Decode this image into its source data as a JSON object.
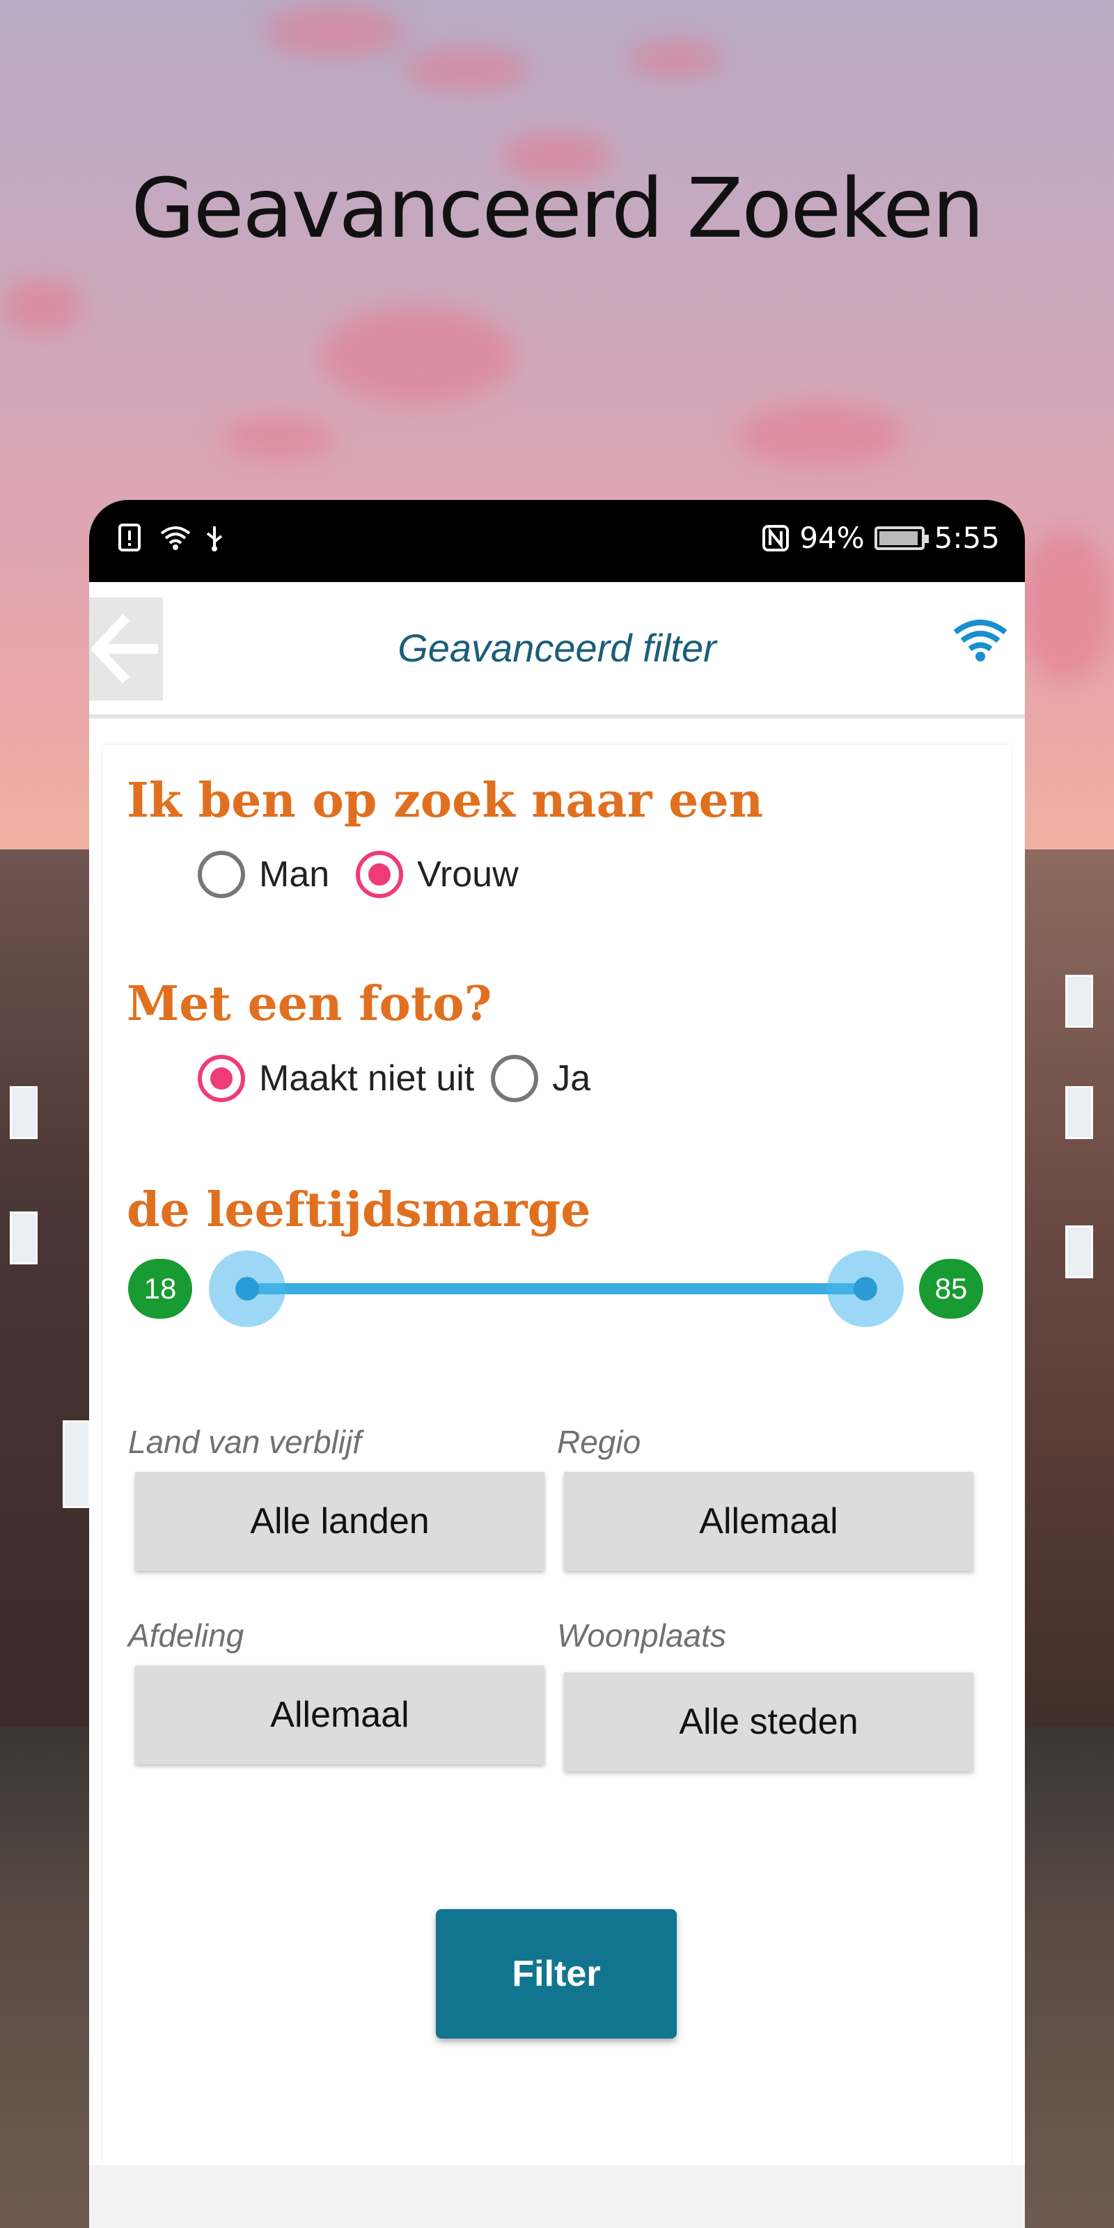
{
  "headline": "Geavanceerd Zoeken",
  "status_bar": {
    "battery_percent": "94%",
    "time": "5:55",
    "battery_level": 0.94
  },
  "app_bar": {
    "title": "Geavanceerd filter"
  },
  "looking_for": {
    "title": "Ik ben op zoek naar een",
    "options": [
      "Man",
      "Vrouw"
    ],
    "selected": "Vrouw"
  },
  "photo": {
    "title": "Met een foto?",
    "options": [
      "Maakt niet uit",
      "Ja"
    ],
    "selected": "Maakt niet uit"
  },
  "age": {
    "title": "de leeftijdsmarge",
    "min": "18",
    "max": "85"
  },
  "fields": {
    "country": {
      "label": "Land van verblijf",
      "value": "Alle landen"
    },
    "region": {
      "label": "Regio",
      "value": "Allemaal"
    },
    "department": {
      "label": "Afdeling",
      "value": "Allemaal"
    },
    "city": {
      "label": "Woonplaats",
      "value": "Alle steden"
    }
  },
  "filter_button": "Filter",
  "colors": {
    "accent_orange": "#e0701f",
    "radio_pink": "#ee3c78",
    "slider_blue": "#3aaee0",
    "badge_green": "#179b32",
    "button_teal": "#127590",
    "title_blue": "#1b5e7a"
  }
}
